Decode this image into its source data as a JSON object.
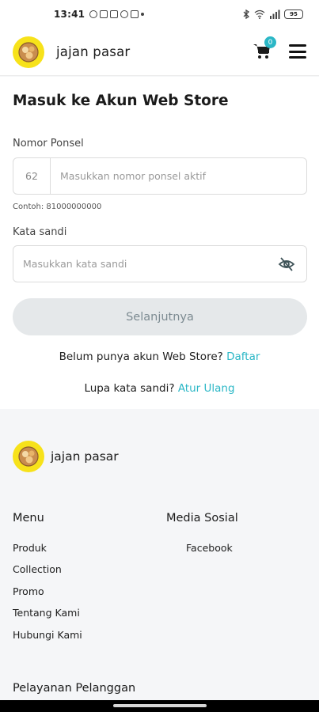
{
  "status_bar": {
    "time": "13:41",
    "battery": "95"
  },
  "header": {
    "brand": "jajan pasar",
    "cart_count": "0"
  },
  "login": {
    "title": "Masuk ke Akun Web Store",
    "phone_label": "Nomor Ponsel",
    "phone_prefix": "62",
    "phone_placeholder": "Masukkan nomor ponsel aktif",
    "phone_hint": "Contoh: 81000000000",
    "password_label": "Kata sandi",
    "password_placeholder": "Masukkan kata sandi",
    "submit_label": "Selanjutnya",
    "register_text": "Belum punya akun Web Store?",
    "register_link": "Daftar",
    "forgot_text": "Lupa kata sandi?",
    "forgot_link": "Atur Ulang"
  },
  "footer": {
    "brand": "jajan pasar",
    "menu_heading": "Menu",
    "menu_items": [
      "Produk",
      "Collection",
      "Promo",
      "Tentang Kami",
      "Hubungi Kami"
    ],
    "social_heading": "Media Sosial",
    "social_items": [
      "Facebook"
    ],
    "service_heading": "Pelayanan Pelanggan"
  },
  "colors": {
    "accent": "#2bb7c6",
    "logo_bg": "#f7e21a",
    "button_disabled_bg": "#e5e8ea",
    "footer_bg": "#f5f6f8"
  }
}
